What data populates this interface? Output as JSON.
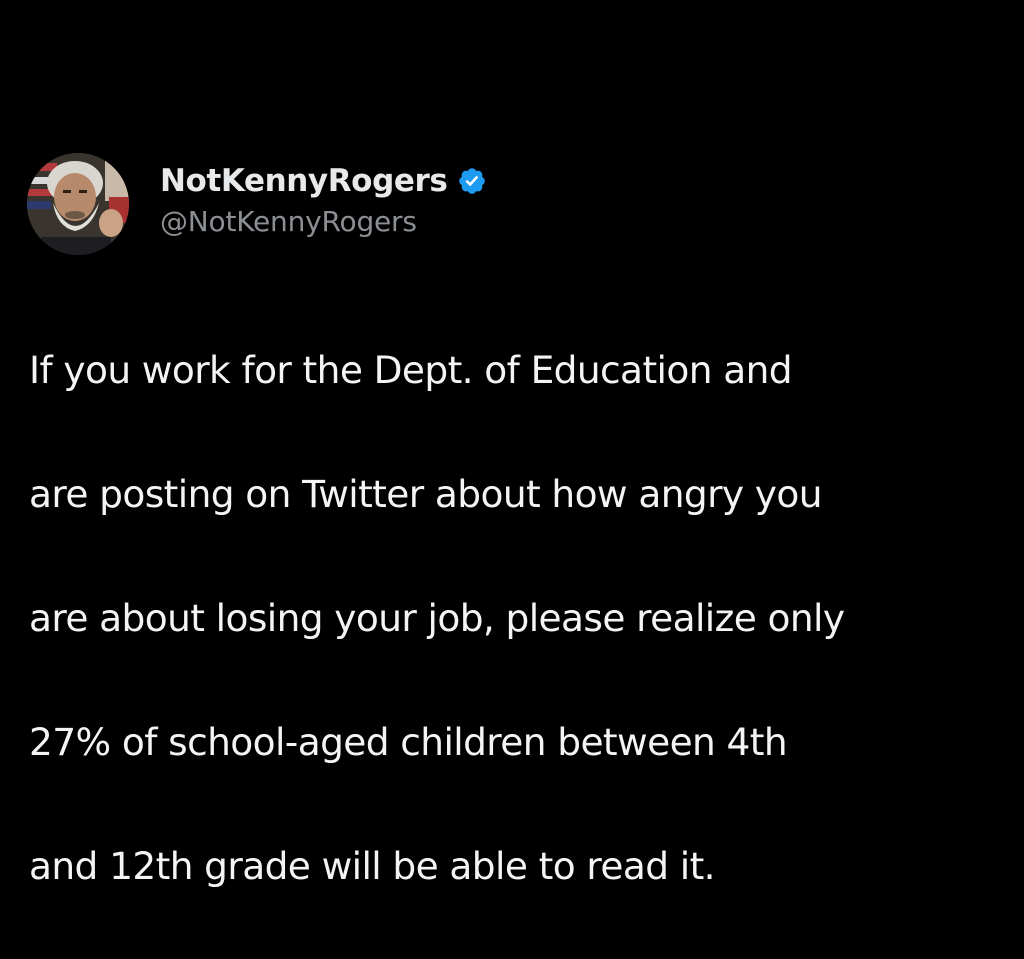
{
  "tweet": {
    "author": {
      "display_name": "NotKennyRogers",
      "handle": "@NotKennyRogers",
      "verified": true,
      "badge_color": "#1d9bf0"
    },
    "text_lines": [
      "If you work for the Dept. of Education and",
      "are posting on Twitter about how angry you",
      "are about losing your job, please realize only",
      "27% of school-aged children between 4th",
      "and 12th grade will be able to read it."
    ]
  },
  "colors": {
    "background": "#000000",
    "name": "#e7e9ea",
    "handle": "#8b8e92",
    "body_text": "#f3f4f5"
  }
}
